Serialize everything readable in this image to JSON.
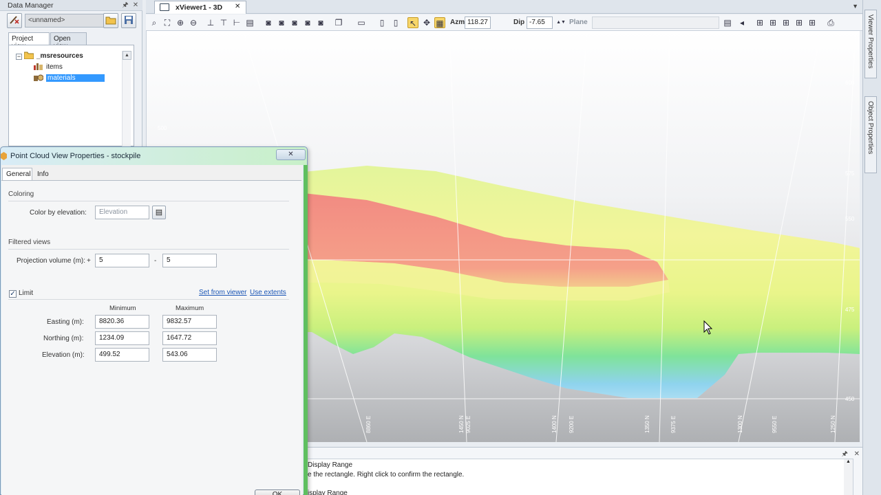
{
  "data_manager": {
    "title": "Data Manager",
    "pin_glyph": "🖈",
    "close_glyph": "✕",
    "workspace": "<unnamed>",
    "tabs": [
      "Project view",
      "Open view"
    ],
    "tree": {
      "root": "_msresources",
      "children": [
        "items",
        "materials"
      ],
      "selected": "materials"
    }
  },
  "viewer": {
    "tab_title": "xViewer1 - 3D",
    "close_glyph": "✕",
    "menu_glyph": "▼",
    "toolbar": {
      "azm_label": "Azm",
      "azm_value": "118.27",
      "dip_label": "Dip",
      "dip_value": "-7.65",
      "plane_label": "Plane"
    },
    "grid_labels": {
      "right_elev": [
        "600",
        "575",
        "550",
        "475",
        "450"
      ],
      "left_elev": [
        "500"
      ],
      "bottom": [
        "8860 E",
        "1450 N",
        "9025 E",
        "1400 N",
        "9200 E",
        "1350 N",
        "9375 E",
        "1300 N",
        "9550 E",
        "1250 N"
      ]
    }
  },
  "right_tabs": [
    "Viewer Properties",
    "Object Properties"
  ],
  "output": {
    "pin_glyph": "🖈",
    "close_glyph": "✕",
    "lines": [
      "Display Range",
      "e the rectangle. Right click to confirm the rectangle.",
      "isplay Range"
    ]
  },
  "dialog": {
    "title": "Point Cloud View Properties - stockpile",
    "tabs": [
      "General",
      "Info"
    ],
    "coloring": {
      "section": "Coloring",
      "color_label": "Color by elevation:",
      "color_value": "Elevation"
    },
    "filtered": {
      "section": "Filtered views",
      "projection_label": "Projection volume (m):",
      "plus": "+",
      "plus_value": "5",
      "minus": "-",
      "minus_value": "5"
    },
    "limit": {
      "label": "Limit",
      "checked": true,
      "set_from_viewer": "Set from viewer",
      "use_extents": "Use extents",
      "col_min": "Minimum",
      "col_max": "Maximum",
      "rows": [
        {
          "label": "Easting (m):",
          "min": "8820.36",
          "max": "9832.57"
        },
        {
          "label": "Northing (m):",
          "min": "1234.09",
          "max": "1647.72"
        },
        {
          "label": "Elevation (m):",
          "min": "499.52",
          "max": "543.06"
        }
      ]
    },
    "ok_label": "OK"
  },
  "colors": {
    "accent_selected": "#3399ff",
    "link": "#1a55b5",
    "elev_high": "#f28b82",
    "elev_mid": "#e6f59a",
    "elev_low": "#8fd3ee"
  }
}
